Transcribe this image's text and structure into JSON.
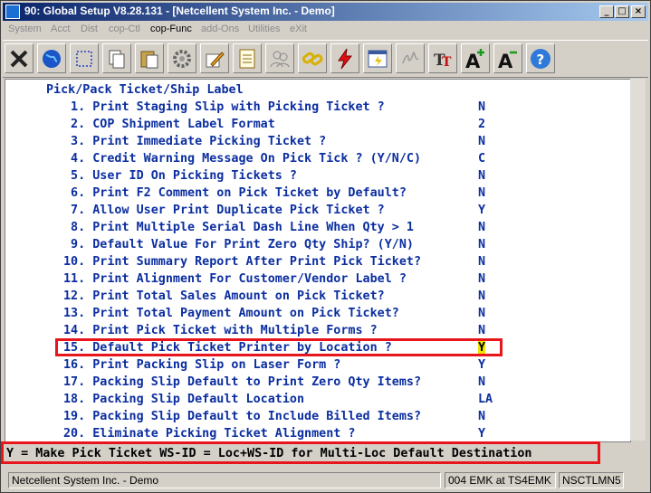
{
  "window": {
    "title": "90: Global Setup V8.28.131 - [Netcellent System Inc. - Demo]",
    "controls": [
      "_",
      "□",
      "×"
    ]
  },
  "menu": [
    {
      "label": "System",
      "enabled": false
    },
    {
      "label": "Acct",
      "enabled": false
    },
    {
      "label": "Dist",
      "enabled": false
    },
    {
      "label": "cop-Ctl",
      "enabled": false
    },
    {
      "label": "cop-Func",
      "enabled": true
    },
    {
      "label": "add-Ons",
      "enabled": false
    },
    {
      "label": "Utilities",
      "enabled": false
    },
    {
      "label": "eXit",
      "enabled": false
    }
  ],
  "toolbar": [
    "close-x-icon",
    "globe-icon",
    "select-box-icon",
    "copy-icon",
    "paste-icon",
    "settings-gear-icon",
    "edit-pencil-icon",
    "notepad-icon",
    "people-icon",
    "chain-link-icon",
    "lightning-icon",
    "chart-window-icon",
    "signature-icon",
    "text-font-icon",
    "font-increase-icon",
    "font-decrease-icon",
    "help-icon"
  ],
  "screen": {
    "heading": "Pick/Pack Ticket/Ship Label",
    "items": [
      {
        "num": " 1.",
        "label": "Print Staging Slip with Picking Ticket ?",
        "value": "N"
      },
      {
        "num": " 2.",
        "label": "COP Shipment Label Format",
        "value": "2"
      },
      {
        "num": " 3.",
        "label": "Print Immediate Picking Ticket ?",
        "value": "N"
      },
      {
        "num": " 4.",
        "label": "Credit Warning Message On Pick Tick ? (Y/N/C)",
        "value": "C"
      },
      {
        "num": " 5.",
        "label": "User ID On Picking Tickets ?",
        "value": "N"
      },
      {
        "num": " 6.",
        "label": "Print F2 Comment on Pick Ticket by Default?",
        "value": "N"
      },
      {
        "num": " 7.",
        "label": "Allow User Print Duplicate Pick Ticket ?",
        "value": "Y"
      },
      {
        "num": " 8.",
        "label": "Print Multiple Serial Dash Line When Qty > 1",
        "value": "N"
      },
      {
        "num": " 9.",
        "label": "Default Value For Print Zero Qty Ship? (Y/N)",
        "value": "N"
      },
      {
        "num": "10.",
        "label": "Print Summary Report After Print Pick Ticket?",
        "value": "N"
      },
      {
        "num": "11.",
        "label": "Print Alignment For Customer/Vendor Label ?",
        "value": "N"
      },
      {
        "num": "12.",
        "label": "Print Total Sales Amount on Pick Ticket?",
        "value": "N"
      },
      {
        "num": "13.",
        "label": "Print Total Payment Amount on Pick Ticket?",
        "value": "N"
      },
      {
        "num": "14.",
        "label": "Print Pick Ticket with Multiple Forms ?",
        "value": "N"
      },
      {
        "num": "15.",
        "label": "Default Pick Ticket Printer by Location ?",
        "value": "Y"
      },
      {
        "num": "16.",
        "label": "Print Packing Slip on Laser Form ?",
        "value": "Y"
      },
      {
        "num": "17.",
        "label": "Packing Slip Default to Print Zero Qty Items?",
        "value": "N"
      },
      {
        "num": "18.",
        "label": "Packing Slip Default Location",
        "value": "LA"
      },
      {
        "num": "19.",
        "label": "Packing Slip Default to Include Billed Items?",
        "value": "N"
      },
      {
        "num": "20.",
        "label": "Eliminate Picking Ticket Alignment ?",
        "value": "Y"
      }
    ],
    "active_item": 15
  },
  "help_line": "Y = Make Pick Ticket WS-ID = Loc+WS-ID for Multi-Loc Default Destination",
  "status": {
    "company": "Netcellent System Inc. - Demo",
    "session": "004 EMK at TS4EMK",
    "machine": "NSCTLMN5"
  },
  "colors": {
    "title_start": "#0a246a",
    "screen_text": "#0b2ea0",
    "highlight_border": "#e8161c",
    "cursor": "#f0e400"
  }
}
